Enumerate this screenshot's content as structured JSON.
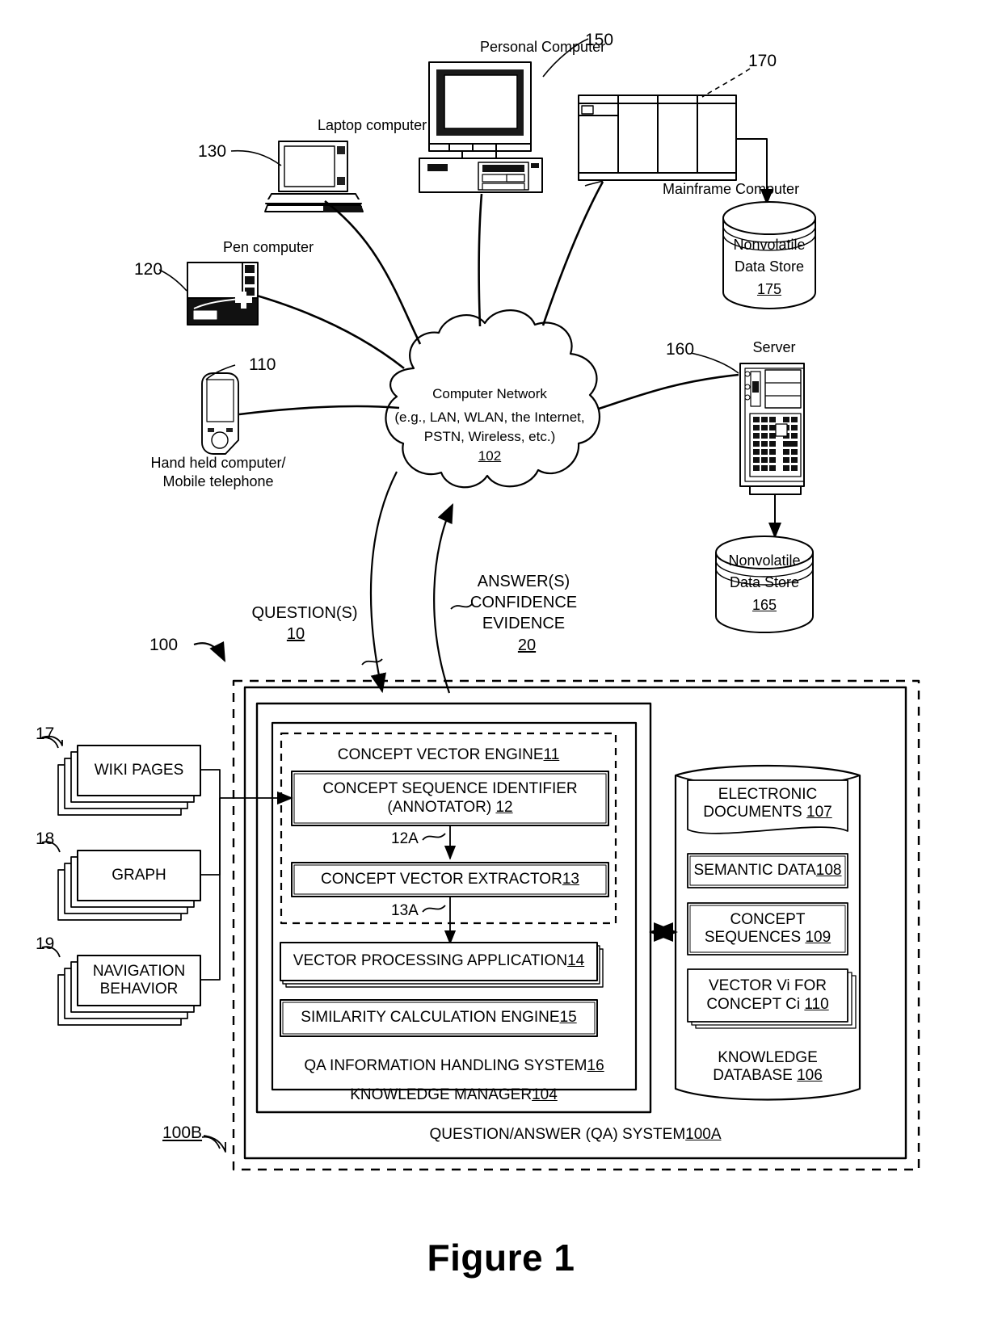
{
  "figure": {
    "caption": "Figure 1"
  },
  "network": {
    "label_line1": "Computer Network",
    "label_line2": "(e.g., LAN, WLAN, the Internet,",
    "label_line3": "PSTN, Wireless, etc.)",
    "ref": "102"
  },
  "devices": [
    {
      "name": "Personal Computer",
      "ref": "150",
      "icon": "desktop-computer-icon"
    },
    {
      "name": "Mainframe Computer",
      "ref": "170",
      "icon": "mainframe-icon"
    },
    {
      "name": "Laptop computer",
      "ref": "130",
      "icon": "laptop-icon"
    },
    {
      "name": "Pen computer",
      "ref": "120",
      "icon": "pen-computer-icon"
    },
    {
      "name": "Hand held computer/",
      "name2": "Mobile telephone",
      "ref": "110",
      "icon": "handheld-phone-icon"
    },
    {
      "name": "Server",
      "ref": "160",
      "icon": "server-icon"
    }
  ],
  "data_stores": [
    {
      "line1": "Nonvolatile",
      "line2": "Data Store",
      "ref": "175",
      "icon": "cylinder-database-icon"
    },
    {
      "line1": "Nonvolatile",
      "line2": "Data Store",
      "ref": "165",
      "icon": "cylinder-database-icon"
    }
  ],
  "flows": {
    "question_label": "QUESTION(S)",
    "question_ref": "10",
    "answer_line1": "ANSWER(S)",
    "answer_line2": "CONFIDENCE",
    "answer_line3": "EVIDENCE",
    "answer_ref": "20"
  },
  "system_refs": {
    "overall": "100",
    "outer_dashed": "100B"
  },
  "inputs": [
    {
      "label": "WIKI PAGES",
      "ref": "17"
    },
    {
      "label": "GRAPH",
      "ref": "18"
    },
    {
      "label": "NAVIGATION BEHAVIOR",
      "ref": "19"
    }
  ],
  "qa_system": {
    "label": "QUESTION/ANSWER (QA) SYSTEM ",
    "ref": "100A"
  },
  "knowledge_manager": {
    "label": "KNOWLEDGE MANAGER ",
    "ref": "104"
  },
  "qa_ihs": {
    "label": "QA INFORMATION HANDLING SYSTEM ",
    "ref": "16"
  },
  "concept_vector_engine": {
    "label": "CONCEPT VECTOR ENGINE ",
    "ref": "11"
  },
  "modules": [
    {
      "label_line1": "CONCEPT SEQUENCE IDENTIFIER",
      "label_line2": "(ANNOTATOR) ",
      "ref": "12"
    },
    {
      "label_line1": "CONCEPT VECTOR EXTRACTOR ",
      "label_line2": "",
      "ref": "13"
    },
    {
      "label_line1": "VECTOR PROCESSING APPLICATION ",
      "label_line2": "",
      "ref": "14"
    },
    {
      "label_line1": "SIMILARITY CALCULATION ENGINE ",
      "label_line2": "",
      "ref": "15"
    }
  ],
  "connectors": [
    {
      "label": "12A"
    },
    {
      "label": "13A"
    }
  ],
  "knowledge_database": {
    "label_line1": "KNOWLEDGE",
    "label_line2": "DATABASE ",
    "ref": "106",
    "items": [
      {
        "line1": "ELECTRONIC",
        "line2": "DOCUMENTS ",
        "ref": "107"
      },
      {
        "line1": "SEMANTIC DATA ",
        "line2": "",
        "ref": "108"
      },
      {
        "line1": "CONCEPT",
        "line2": "SEQUENCES ",
        "ref": "109"
      },
      {
        "line1": "VECTOR Vi FOR",
        "line2": "CONCEPT Ci ",
        "ref": "110"
      }
    ]
  },
  "colors": {
    "ink": "#000000",
    "paper": "#ffffff"
  }
}
